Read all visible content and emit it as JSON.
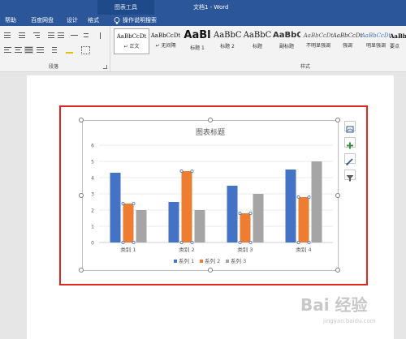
{
  "window": {
    "tool_tab": "图表工具",
    "title": "文档1 - Word"
  },
  "tabs": [
    "帮助",
    "百度网盘",
    "设计",
    "格式"
  ],
  "tell_me": "操作说明搜索",
  "ribbon": {
    "paragraph_group_label": "段落",
    "styles_group_label": "样式",
    "styles": [
      {
        "preview": "AaBbCcDt",
        "name": "↵ 正文",
        "selected": true
      },
      {
        "preview": "AaBbCcDt",
        "name": "↵ 无间隔",
        "selected": false
      },
      {
        "preview": "AaBl",
        "name": "标题 1",
        "selected": false
      },
      {
        "preview": "AaBbC",
        "name": "标题 2",
        "selected": false
      },
      {
        "preview": "AaBbC",
        "name": "标题",
        "selected": false
      },
      {
        "preview": "AaBbC",
        "name": "副标题",
        "selected": false
      },
      {
        "preview": "AaBbCcDt",
        "name": "不明显强调",
        "selected": false
      },
      {
        "preview": "AaBbCcDt",
        "name": "强调",
        "selected": false
      },
      {
        "preview": "AaBbCcDt",
        "name": "明显强调",
        "selected": false
      },
      {
        "preview": "AaBbCcDt",
        "name": "要点",
        "selected": false
      }
    ]
  },
  "chart_data": {
    "type": "bar",
    "title": "图表标题",
    "categories": [
      "类别 1",
      "类别 2",
      "类别 3",
      "类别 4"
    ],
    "series": [
      {
        "name": "系列 1",
        "color": "#4472c4",
        "values": [
          4.3,
          2.5,
          3.5,
          4.5
        ]
      },
      {
        "name": "系列 2",
        "color": "#ed7d31",
        "values": [
          2.4,
          4.4,
          1.8,
          2.8
        ]
      },
      {
        "name": "系列 3",
        "color": "#a5a5a5",
        "values": [
          2,
          2,
          3,
          5
        ]
      }
    ],
    "ylim": [
      0,
      6
    ],
    "yticks": [
      "0",
      "1",
      "2",
      "3",
      "4",
      "5",
      "6"
    ],
    "grid": true,
    "legend": "bottom",
    "selected_series": "系列 2"
  },
  "chart_tools": [
    "chart-layout-icon",
    "add-element-icon",
    "chart-style-icon",
    "chart-filter-icon"
  ],
  "watermark": {
    "text": "Bai 经验",
    "sub": "jingyan.baidu.com"
  }
}
